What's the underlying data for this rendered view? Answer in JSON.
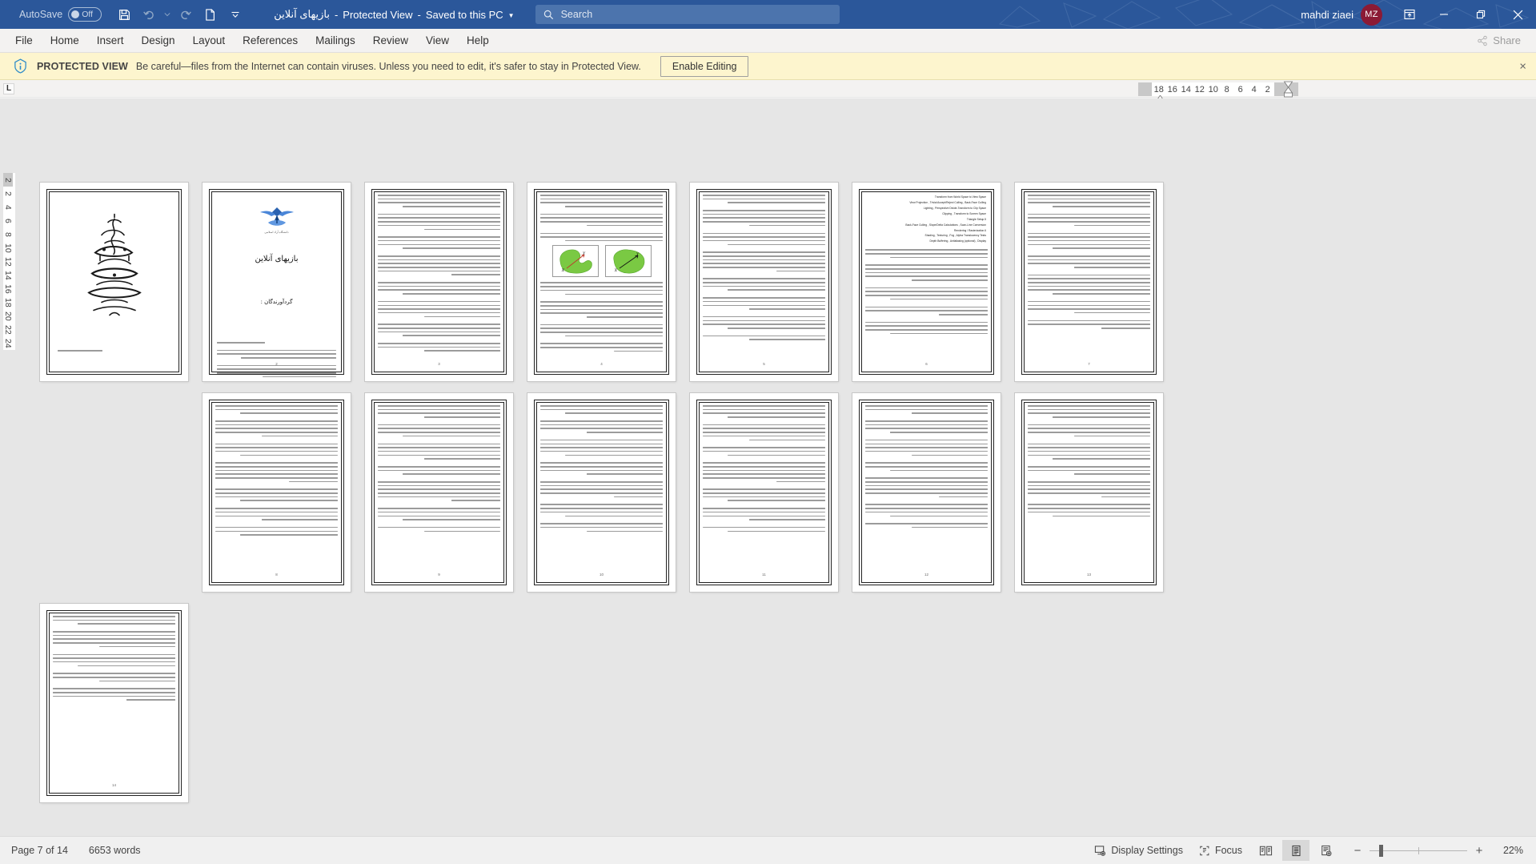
{
  "titlebar": {
    "autosave_label": "AutoSave",
    "autosave_state": "Off",
    "save_icon": "save-icon",
    "undo_icon": "undo-icon",
    "redo_icon": "redo-icon",
    "new_icon": "new-document-icon",
    "customize_icon": "customize-qat-icon",
    "document_name": "بازیهای آنلاین",
    "protected_view_label": "Protected View",
    "saved_label": "Saved to this PC",
    "search_placeholder": "Search",
    "search_icon": "search-icon",
    "user_name": "mahdi ziaei",
    "user_initials": "MZ",
    "ribbon_display_icon": "ribbon-display-options-icon",
    "minimize_label": "Minimize",
    "restore_label": "Restore Down",
    "close_label": "Close",
    "accent_color": "#2b579a",
    "avatar_color": "#8b1a35"
  },
  "ribbon": {
    "tabs": [
      {
        "label": "File"
      },
      {
        "label": "Home"
      },
      {
        "label": "Insert"
      },
      {
        "label": "Design"
      },
      {
        "label": "Layout"
      },
      {
        "label": "References"
      },
      {
        "label": "Mailings"
      },
      {
        "label": "Review"
      },
      {
        "label": "View"
      },
      {
        "label": "Help"
      }
    ],
    "share_label": "Share",
    "share_icon": "share-icon"
  },
  "protected_view": {
    "icon": "info-shield-icon",
    "title": "PROTECTED VIEW",
    "message": "Be careful—files from the Internet can contain viruses. Unless you need to edit, it's safer to stay in Protected View.",
    "button_label": "Enable Editing",
    "close_label": "×",
    "background": "#fdf5ce"
  },
  "rulers": {
    "tabstop_glyph": "L",
    "horizontal_ticks": [
      "18",
      "16",
      "14",
      "12",
      "10",
      "8",
      "6",
      "4",
      "2"
    ],
    "vertical_ticks": [
      "2",
      "2",
      "4",
      "6",
      "8",
      "10",
      "12",
      "14",
      "16",
      "18",
      "20",
      "22",
      "24"
    ]
  },
  "document": {
    "cover": {
      "university": "دانشگاه آزاد اسلامی",
      "title": "بازیهای آنلاین",
      "subtitle": "گردآورندگان :"
    },
    "page_numbers": [
      "1",
      "2",
      "3",
      "4",
      "5",
      "6",
      "7",
      "8",
      "9",
      "10",
      "11",
      "12",
      "13",
      "14"
    ],
    "figure_caption": "نمودار شکل محدب و غیر محدب",
    "figure_labels": [
      "X",
      "Y"
    ],
    "figure_color": "#7ac943",
    "pipeline_list": [
      "Transform from World Space to View Space",
      "View Projection , Trivial Accept/Reject Culling , Back-Face Culling",
      "Lighting , Perspective Divide-Transform to Clip Space",
      "Clipping , Transform to Screen Space",
      "Triangle Setup.5",
      "Back-Face Culling , Slope/Delta Calculations , Scan-Line Conversion",
      "Rendering / Rasterization.6",
      "Shading , Texturing , Fog , Alpha Translucency Tests",
      "Depth Buffering , Antialiasing (optional) , Display"
    ],
    "applications_list": [
      "Application/Scene.1",
      "Scene Geometry database traversal",
      "Movement of objects and of movement of view camera",
      "Animated movement of object models",
      "Description of scene content",
      "Object Visibility Check including possible Occlusion Culling",
      "(Select: Level of Detail (LOD",
      "Geometry.2",
      "(Transforms (rotation, translation, scaling",
      "(3)Transform from Model Space to World Space (Direct"
    ]
  },
  "statusbar": {
    "page_label": "Page 7 of 14",
    "words_label": "6653 words",
    "display_settings_label": "Display Settings",
    "display_settings_icon": "display-settings-icon",
    "focus_label": "Focus",
    "focus_icon": "focus-icon",
    "read_mode_icon": "read-mode-icon",
    "print_layout_icon": "print-layout-icon",
    "web_layout_icon": "web-layout-icon",
    "zoom_out_label": "−",
    "zoom_in_label": "+",
    "zoom_level": "22%"
  }
}
